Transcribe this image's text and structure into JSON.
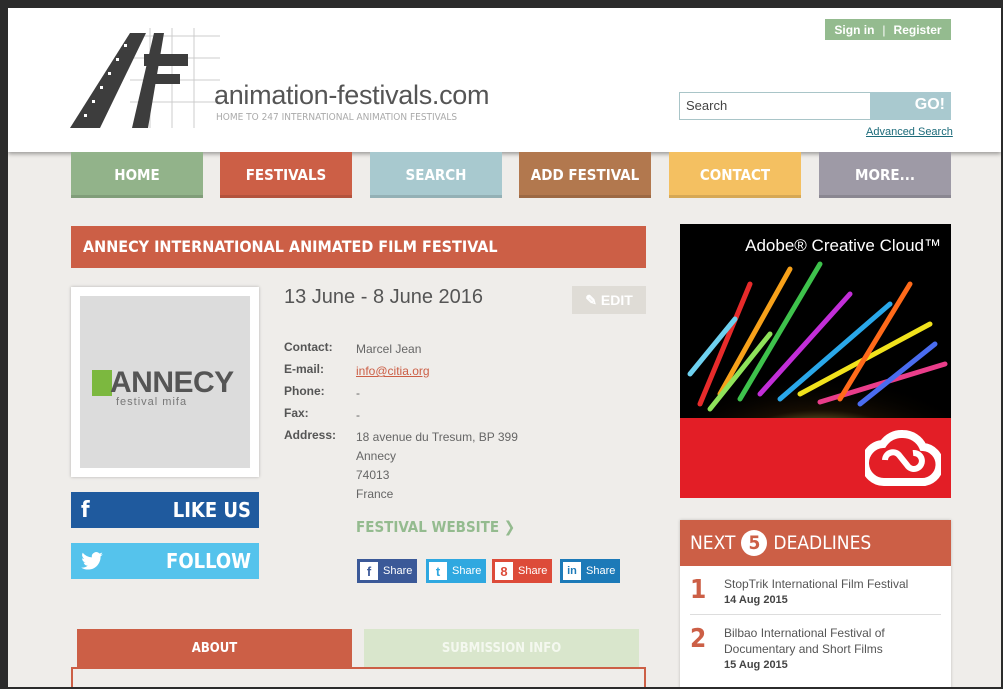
{
  "auth": {
    "sign_in": "Sign in",
    "separator": "|",
    "register": "Register"
  },
  "site": {
    "name": "animation-festivals.com",
    "tagline": "HOME TO 247 INTERNATIONAL ANIMATION FESTIVALS"
  },
  "search": {
    "placeholder": "Search",
    "go_label": "GO!",
    "advanced_label": "Advanced Search"
  },
  "nav": [
    {
      "label": "HOME",
      "color": "#92b38a"
    },
    {
      "label": "FESTIVALS",
      "color": "#cc5f46"
    },
    {
      "label": "SEARCH",
      "color": "#a8c9cf"
    },
    {
      "label": "ADD FESTIVAL",
      "color": "#b2784e"
    },
    {
      "label": "CONTACT",
      "color": "#f4c061"
    },
    {
      "label": "MORE...",
      "color": "#9e9aa6"
    }
  ],
  "festival": {
    "title": "ANNECY INTERNATIONAL ANIMATED FILM FESTIVAL",
    "dates": "13 June - 8 June 2016",
    "edit_label": "EDIT",
    "logo_text": "ANNECY",
    "logo_subtext": "festival mifa",
    "contact_label": "Contact:",
    "contact": "Marcel Jean",
    "email_label": "E-mail:",
    "email": "info@citia.org",
    "phone_label": "Phone:",
    "phone": "-",
    "fax_label": "Fax:",
    "fax": "-",
    "address_label": "Address:",
    "address_line1": "18 avenue du Tresum, BP 399",
    "address_line2": "Annecy",
    "address_line3": "74013",
    "address_line4": "France",
    "website_label": "FESTIVAL WEBSITE"
  },
  "social": {
    "like_label": "LIKE US",
    "follow_label": "FOLLOW",
    "facebook_color": "#1f5a9e",
    "twitter_color": "#55c3ec"
  },
  "share": [
    {
      "label": "Share",
      "icon": "facebook-icon",
      "glyph": "f",
      "color": "#3b5998"
    },
    {
      "label": "Share",
      "icon": "twitter-icon",
      "glyph": "t",
      "color": "#2fa8e0"
    },
    {
      "label": "Share",
      "icon": "google-plus-icon",
      "glyph": "8",
      "color": "#dd4b39"
    },
    {
      "label": "Share",
      "icon": "linkedin-icon",
      "glyph": "in",
      "color": "#1c7ab8"
    }
  ],
  "tabs": [
    {
      "label": "ABOUT",
      "active": true
    },
    {
      "label": "SUBMISSION INFO",
      "active": false
    }
  ],
  "ad": {
    "title": "Adobe® Creative Cloud™"
  },
  "deadlines": {
    "prefix": "NEXT",
    "count": "5",
    "suffix": "DEADLINES",
    "items": [
      {
        "rank": "1",
        "name": "StopTrik International Film Festival",
        "date": "14 Aug 2015"
      },
      {
        "rank": "2",
        "name": "Bilbao International Festival of Documentary and Short Films",
        "date": "15 Aug 2015"
      }
    ]
  }
}
